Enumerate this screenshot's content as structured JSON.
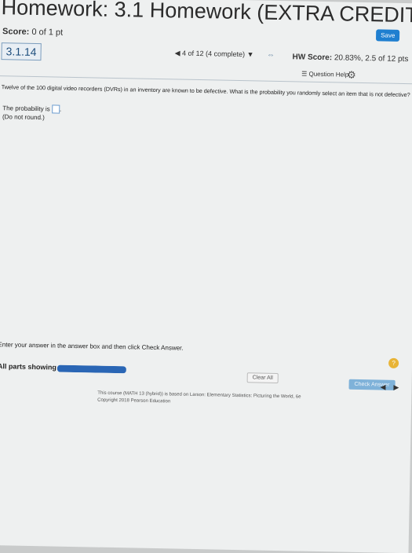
{
  "title": "Homework: 3.1 Homework (EXTRA CREDIT)",
  "save_label": "Save",
  "score": {
    "label": "Score:",
    "value": "0 of 1 pt"
  },
  "hw_score": {
    "label": "HW Score:",
    "value": "20.83%, 2.5 of 12 pts"
  },
  "question_number": "3.1.14",
  "navigation": {
    "prev": "◀",
    "text": "4 of 12 (4 complete)",
    "next": "▼",
    "scroll_icon": "scroll-icon"
  },
  "question_help": "Question Help",
  "question_text": "Twelve of the 100 digital video recorders (DVRs) in an inventory are known to be defective. What is the probability you randomly select an item that is not defective?",
  "answer_prefix": "The probability is",
  "answer_value": "",
  "answer_suffix": ".",
  "answer_note": "(Do not round.)",
  "instructions": "Enter your answer in the answer box and then click Check Answer.",
  "parts_label": "All parts showing",
  "progress": 1.0,
  "clear_all_label": "Clear All",
  "check_answer_label": "Check Answer",
  "help_symbol": "?",
  "bottom_nav": {
    "prev": "◀",
    "next": "▶"
  },
  "footer": {
    "line1": "This course (MATH 13 (hybrid)) is based on Larson: Elementary Statistics: Picturing the World, 6e",
    "line2": "Copyright 2018 Pearson Education"
  },
  "colors": {
    "accent": "#2a66b5",
    "save": "#1f7fd0",
    "check": "#7fb2d9",
    "help": "#e8b437"
  }
}
